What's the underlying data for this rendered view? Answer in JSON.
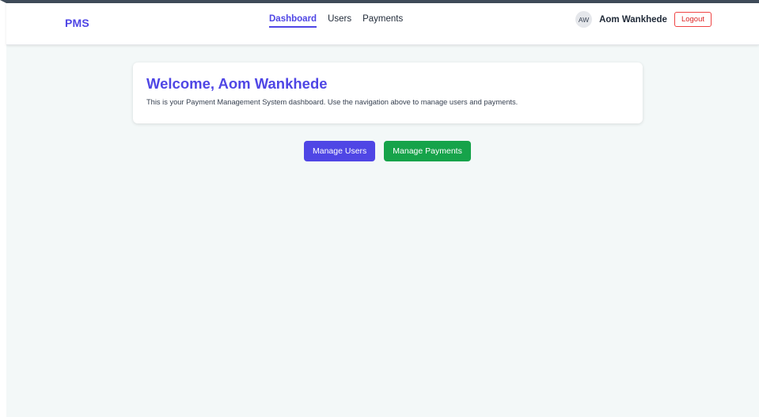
{
  "navbar": {
    "brand": "PMS",
    "links": [
      {
        "label": "Dashboard",
        "active": true
      },
      {
        "label": "Users",
        "active": false
      },
      {
        "label": "Payments",
        "active": false
      }
    ],
    "user": {
      "initials": "AW",
      "name": "Aom Wankhede"
    },
    "logout_label": "Logout"
  },
  "main": {
    "welcome_title": "Welcome, Aom Wankhede",
    "welcome_text": "This is your Payment Management System dashboard. Use the navigation above to manage users and payments.",
    "actions": {
      "manage_users_label": "Manage Users",
      "manage_payments_label": "Manage Payments"
    }
  },
  "colors": {
    "accent": "#4f46e5",
    "success": "#16a34a",
    "danger": "#dc2626",
    "background": "#f3f8f8"
  }
}
